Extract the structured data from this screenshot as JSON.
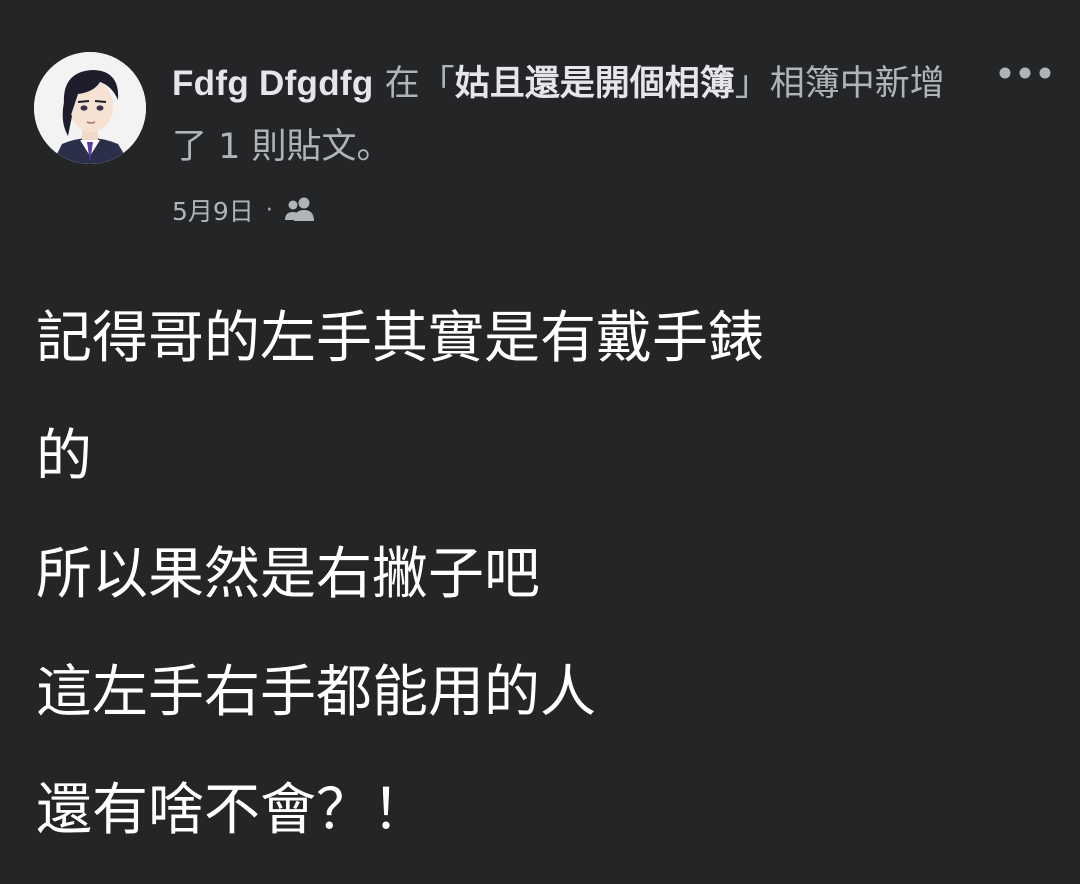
{
  "post": {
    "author_name": "Fdfg Dfgdfg",
    "action_prefix": " 在「",
    "album_name": "姑且還是開個相簿",
    "action_suffix": "」相簿中新增了 1 則貼文。",
    "date": "5月9日",
    "separator": "·",
    "audience_icon": "friends-icon",
    "more_icon": "more-horizontal-icon",
    "body_lines": [
      "記得哥的左手其實是有戴手錶",
      "的",
      "所以果然是右撇子吧",
      "這左手右手都能用的人",
      "還有啥不會？！"
    ]
  },
  "colors": {
    "background": "#242526",
    "primary_text": "#e4e6eb",
    "secondary_text": "#b0b3b8",
    "body_text": "#ffffff"
  }
}
